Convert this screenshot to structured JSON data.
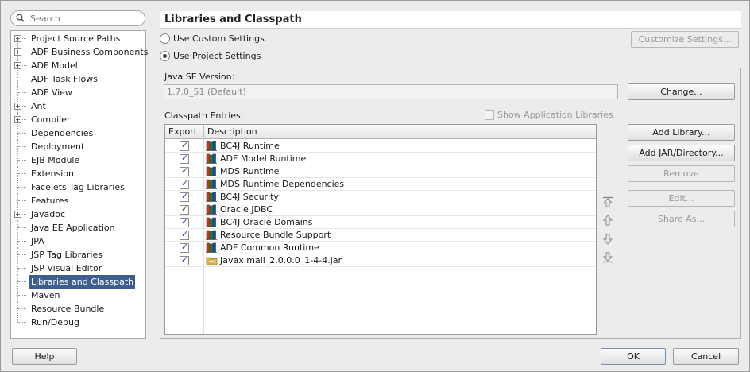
{
  "search": {
    "placeholder": "Search"
  },
  "tree": {
    "items": [
      {
        "label": "Project Source Paths",
        "expandable": true,
        "selected": false
      },
      {
        "label": "ADF Business Components",
        "expandable": true,
        "selected": false
      },
      {
        "label": "ADF Model",
        "expandable": true,
        "selected": false
      },
      {
        "label": "ADF Task Flows",
        "expandable": false,
        "selected": false
      },
      {
        "label": "ADF View",
        "expandable": false,
        "selected": false
      },
      {
        "label": "Ant",
        "expandable": true,
        "selected": false
      },
      {
        "label": "Compiler",
        "expandable": true,
        "selected": false
      },
      {
        "label": "Dependencies",
        "expandable": false,
        "selected": false
      },
      {
        "label": "Deployment",
        "expandable": false,
        "selected": false
      },
      {
        "label": "EJB Module",
        "expandable": false,
        "selected": false
      },
      {
        "label": "Extension",
        "expandable": false,
        "selected": false
      },
      {
        "label": "Facelets Tag Libraries",
        "expandable": false,
        "selected": false
      },
      {
        "label": "Features",
        "expandable": false,
        "selected": false
      },
      {
        "label": "Javadoc",
        "expandable": true,
        "selected": false
      },
      {
        "label": "Java EE Application",
        "expandable": false,
        "selected": false
      },
      {
        "label": "JPA",
        "expandable": false,
        "selected": false
      },
      {
        "label": "JSP Tag Libraries",
        "expandable": false,
        "selected": false
      },
      {
        "label": "JSP Visual Editor",
        "expandable": false,
        "selected": false
      },
      {
        "label": "Libraries and Classpath",
        "expandable": false,
        "selected": true
      },
      {
        "label": "Maven",
        "expandable": false,
        "selected": false
      },
      {
        "label": "Resource Bundle",
        "expandable": false,
        "selected": false
      },
      {
        "label": "Run/Debug",
        "expandable": false,
        "selected": false
      }
    ]
  },
  "page": {
    "title": "Libraries and Classpath"
  },
  "settings": {
    "custom_label": "Use Custom Settings",
    "project_label": "Use Project Settings",
    "selected": "project",
    "customize_button": "Customize Settings..."
  },
  "java_se": {
    "label": "Java SE Version:",
    "value": "1.7.0_51 (Default)",
    "change_button": "Change..."
  },
  "classpath": {
    "label": "Classpath Entries:",
    "show_app_libraries": "Show Application Libraries",
    "columns": {
      "export": "Export",
      "description": "Description"
    },
    "entries": [
      {
        "name": "BC4J Runtime",
        "export": true,
        "type": "library"
      },
      {
        "name": "ADF Model Runtime",
        "export": true,
        "type": "library"
      },
      {
        "name": "MDS Runtime",
        "export": true,
        "type": "library"
      },
      {
        "name": "MDS Runtime Dependencies",
        "export": true,
        "type": "library"
      },
      {
        "name": "BC4J Security",
        "export": true,
        "type": "library"
      },
      {
        "name": "Oracle JDBC",
        "export": true,
        "type": "library"
      },
      {
        "name": "BC4J Oracle Domains",
        "export": true,
        "type": "library"
      },
      {
        "name": "Resource Bundle Support",
        "export": true,
        "type": "library"
      },
      {
        "name": "ADF Common Runtime",
        "export": true,
        "type": "library"
      },
      {
        "name": "Javax.mail_2.0.0.0_1-4-4.jar",
        "export": true,
        "type": "jar"
      }
    ]
  },
  "actions": {
    "add_library": "Add Library...",
    "add_jar": "Add JAR/Directory...",
    "remove": "Remove",
    "edit": "Edit...",
    "share_as": "Share As..."
  },
  "footer": {
    "help": "Help",
    "ok": "OK",
    "cancel": "Cancel"
  },
  "colors": {
    "selection": "#3d5f8f",
    "check": "#2a4f8f"
  }
}
